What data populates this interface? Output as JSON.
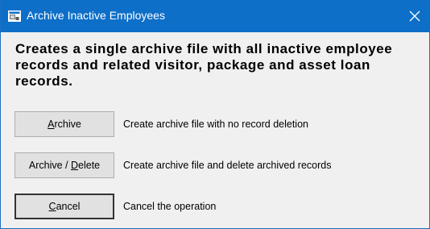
{
  "window": {
    "title": "Archive Inactive Employees",
    "title_icon": "app-window-icon",
    "close_icon": "close-icon",
    "colors": {
      "titlebar": "#0d6fc8",
      "dialog_background": "#f0f0f0",
      "button_background": "#e1e1e1"
    }
  },
  "description": "Creates a single archive file with all inactive employee records and related visitor, package and asset loan records.",
  "options": [
    {
      "label_before": "",
      "mnemonic": "A",
      "label_after": "rchive",
      "description": "Create archive file with no record deletion"
    },
    {
      "label_before": "Archive / ",
      "mnemonic": "D",
      "label_after": "elete",
      "description": "Create archive file and delete archived records"
    },
    {
      "label_before": "",
      "mnemonic": "C",
      "label_after": "ancel",
      "description": "Cancel the operation",
      "is_default": true
    }
  ]
}
